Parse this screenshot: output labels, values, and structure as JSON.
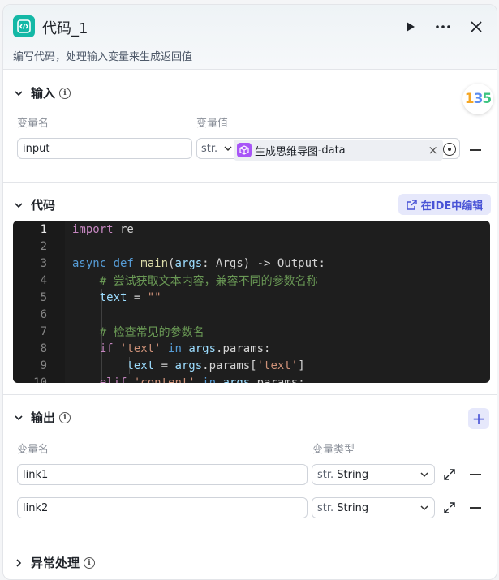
{
  "header": {
    "title": "代码_1",
    "description": "编写代码，处理输入变量来生成返回值",
    "run_icon": "play-icon",
    "more_icon": "more-icon",
    "close_icon": "close-icon"
  },
  "input_section": {
    "title": "输入",
    "col_name": "变量名",
    "col_value": "变量值",
    "row": {
      "name": "input",
      "type_short": "str.",
      "ref_node": "生成思维导图",
      "ref_sep": " - ",
      "ref_var": "data",
      "clear": "×"
    }
  },
  "code_section": {
    "title": "代码",
    "ide_button": "在IDE中编辑",
    "lines": [
      {
        "n": "1",
        "text": "import re"
      },
      {
        "n": "2",
        "text": ""
      },
      {
        "n": "3",
        "text": "async def main(args: Args) -> Output:"
      },
      {
        "n": "4",
        "text": "    # 尝试获取文本内容，兼容不同的参数名称"
      },
      {
        "n": "5",
        "text": "    text = \"\""
      },
      {
        "n": "6",
        "text": ""
      },
      {
        "n": "7",
        "text": "    # 检查常见的参数名"
      },
      {
        "n": "8",
        "text": "    if 'text' in args.params:"
      },
      {
        "n": "9",
        "text": "        text = args.params['text']"
      },
      {
        "n": "10",
        "text": "    elif 'content' in args.params:"
      }
    ]
  },
  "output_section": {
    "title": "输出",
    "col_name": "变量名",
    "col_type": "变量类型",
    "add": "+",
    "rows": [
      {
        "name": "link1",
        "type_short": "str.",
        "type": "String"
      },
      {
        "name": "link2",
        "type_short": "str.",
        "type": "String"
      }
    ]
  },
  "exception_section": {
    "title": "异常处理"
  },
  "badge": {
    "text_1": "1",
    "text_3": "3",
    "text_5": "5"
  },
  "colors": {
    "accent": "#4953d6",
    "logo": "#14b8a6",
    "ref_icon": "#a855f7"
  }
}
